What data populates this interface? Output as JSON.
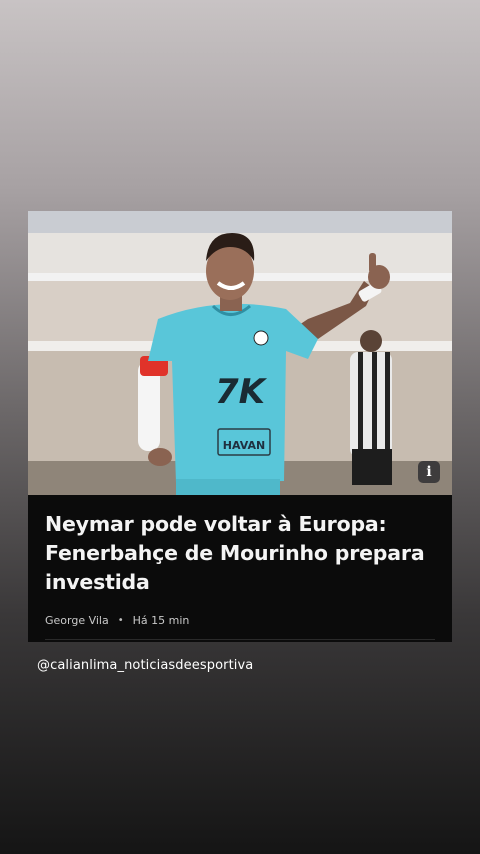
{
  "article": {
    "headline": "Neymar pode voltar à Europa: Fenerbahçe de Mourinho prepara investida",
    "author": "George Vila",
    "separator": "•",
    "time": "Há 15 min",
    "info_icon": "i",
    "jersey_sponsor": "7K",
    "jersey_sponsor_secondary": "HAVAN"
  },
  "story": {
    "mention": "@calianlima_noticiasdeesportiva"
  },
  "colors": {
    "card_background": "#0b0b0b",
    "jersey": "#59c6d9",
    "headline_text": "#f4f4f4"
  }
}
